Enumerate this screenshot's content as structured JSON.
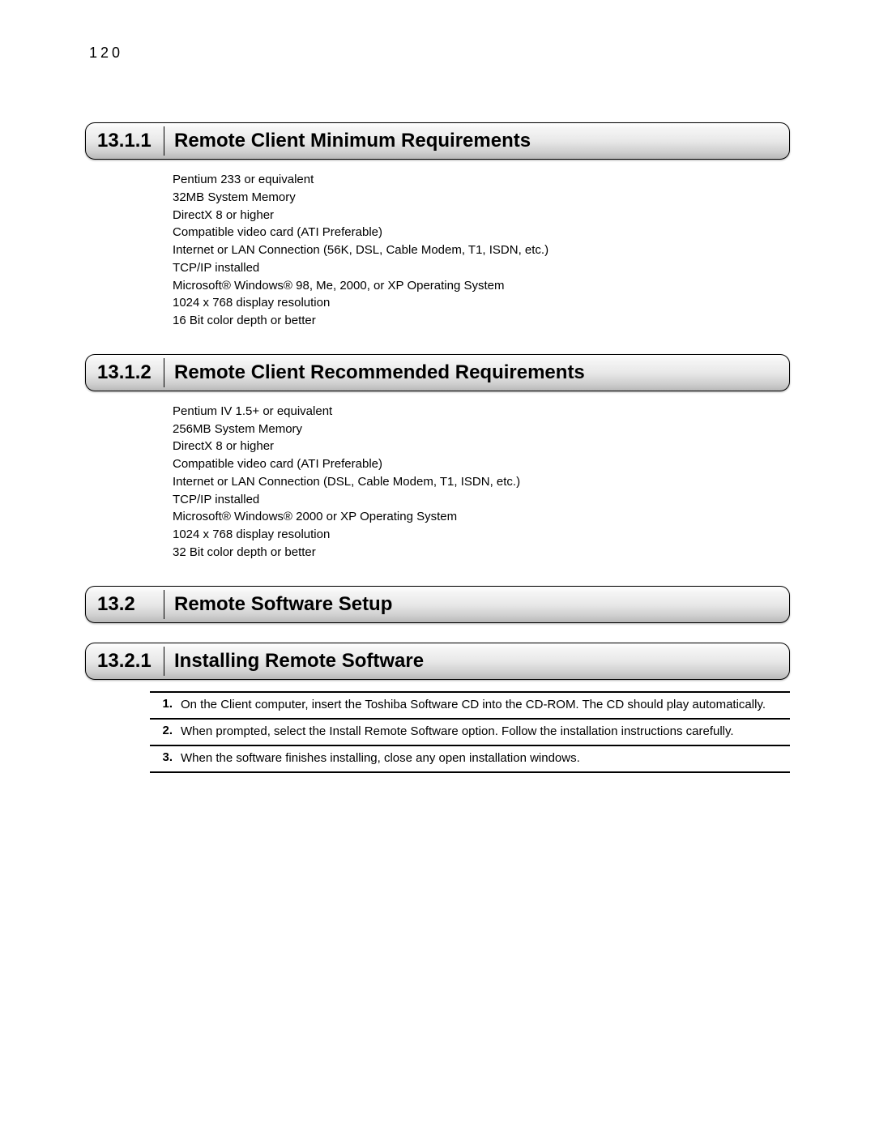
{
  "pageNumber": "120",
  "sections": [
    {
      "num": "13.1.1",
      "title": "Remote Client Minimum Requirements",
      "items": [
        "Pentium 233 or equivalent",
        "32MB System Memory",
        "DirectX 8 or higher",
        "Compatible video card (ATI Preferable)",
        "Internet or LAN Connection (56K, DSL, Cable Modem, T1, ISDN, etc.)",
        "TCP/IP installed",
        "Microsoft® Windows® 98, Me, 2000, or XP Operating System",
        "1024 x 768 display resolution",
        "16 Bit color depth or better"
      ]
    },
    {
      "num": "13.1.2",
      "title": "Remote Client Recommended Requirements",
      "items": [
        "Pentium IV 1.5+ or equivalent",
        "256MB System Memory",
        "DirectX 8 or higher",
        "Compatible video card (ATI Preferable)",
        "Internet or LAN Connection (DSL, Cable Modem, T1, ISDN, etc.)",
        "TCP/IP installed",
        "Microsoft® Windows® 2000 or XP Operating System",
        "1024 x 768 display resolution",
        "32 Bit color depth or better"
      ]
    },
    {
      "num": "13.2",
      "title": "Remote Software Setup"
    },
    {
      "num": "13.2.1",
      "title": "Installing Remote Software",
      "steps": [
        {
          "n": "1.",
          "t": "On the Client computer, insert the Toshiba Software CD into the CD-ROM.  The CD should play automatically."
        },
        {
          "n": "2.",
          "t": "When prompted, select the Install Remote Software option.  Follow the installation instructions carefully."
        },
        {
          "n": "3.",
          "t": "When the software finishes installing, close any open installation windows."
        }
      ]
    }
  ]
}
